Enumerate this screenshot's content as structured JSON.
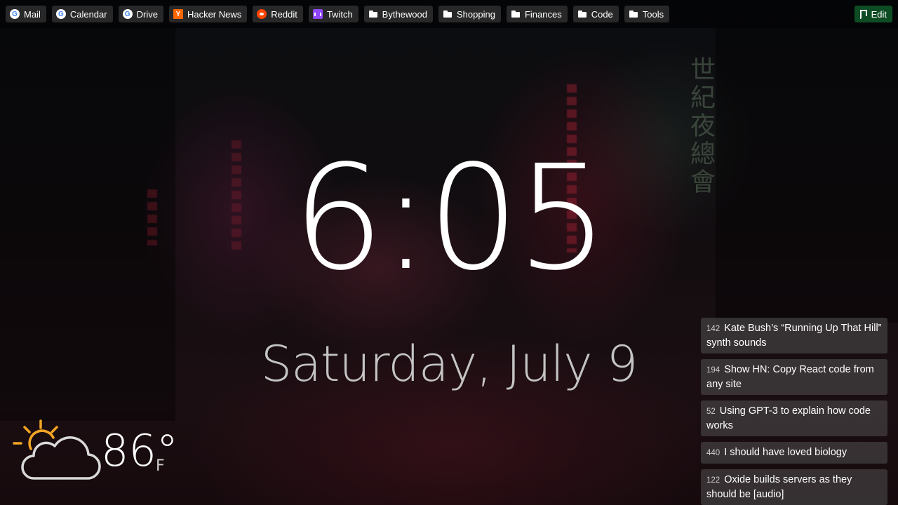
{
  "bookmarks": [
    {
      "label": "Mail",
      "icon": "google-icon"
    },
    {
      "label": "Calendar",
      "icon": "google-icon"
    },
    {
      "label": "Drive",
      "icon": "google-icon"
    },
    {
      "label": "Hacker News",
      "icon": "hacker-news-icon"
    },
    {
      "label": "Reddit",
      "icon": "reddit-icon"
    },
    {
      "label": "Twitch",
      "icon": "twitch-icon"
    },
    {
      "label": "Bythewood",
      "icon": "folder-icon"
    },
    {
      "label": "Shopping",
      "icon": "folder-icon"
    },
    {
      "label": "Finances",
      "icon": "folder-icon"
    },
    {
      "label": "Code",
      "icon": "folder-icon"
    },
    {
      "label": "Tools",
      "icon": "folder-icon"
    }
  ],
  "edit_label": "Edit",
  "icon_glyphs": {
    "google": "G",
    "hacker_news": "Y"
  },
  "clock": {
    "time": "6:05",
    "date": "Saturday, July 9"
  },
  "weather": {
    "temp": "86°",
    "unit": "F",
    "icon": "partly-cloudy-sun-icon"
  },
  "hn": [
    {
      "score": "142",
      "title": "Kate Bush’s “Running Up That Hill” synth sounds"
    },
    {
      "score": "194",
      "title": "Show HN: Copy React code from any site"
    },
    {
      "score": "52",
      "title": "Using GPT-3 to explain how code works"
    },
    {
      "score": "440",
      "title": "I should have loved biology"
    },
    {
      "score": "122",
      "title": "Oxide builds servers as they should be [audio]"
    }
  ],
  "background_sign": "世紀夜總會",
  "colors": {
    "edit_button": "#0e4d24",
    "sun": "#f5a623",
    "hacker_news": "#ff6600",
    "reddit": "#ff4500",
    "twitch": "#9146ff"
  }
}
